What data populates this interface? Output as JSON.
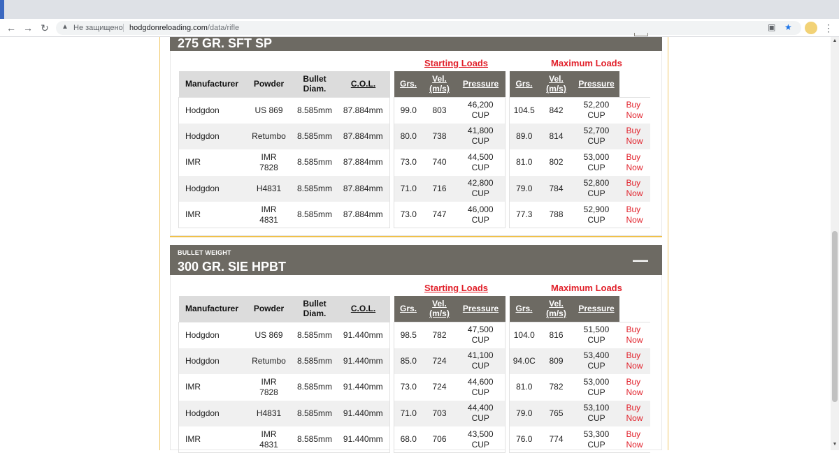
{
  "browser": {
    "security_label": "Не защищено",
    "url_host": "hodgdonreloading.com",
    "url_path": "/data/rifle"
  },
  "headers": {
    "starting": "Starting Loads",
    "maximum": "Maximum Loads",
    "manufacturer": "Manufacturer",
    "powder": "Powder",
    "bullet_diam_1": "Bullet",
    "bullet_diam_2": "Diam.",
    "col": "C.O.L.",
    "grs": "Grs.",
    "vel_1": "Vel.",
    "vel_2": "(m/s)",
    "pressure": "Pressure"
  },
  "sections": [
    {
      "label": "",
      "title": "275 GR. SFT SP",
      "toggle": "",
      "rows": [
        {
          "manufacturer": "Hodgdon",
          "powder1": "US 869",
          "powder2": "",
          "diam": "8.585mm",
          "col": "87.884mm",
          "s_grs": "99.0",
          "s_vel": "803",
          "s_p1": "46,200",
          "s_p2": "CUP",
          "m_grs": "104.5",
          "m_vel": "842",
          "m_p1": "52,200",
          "m_p2": "CUP",
          "buy1": "Buy",
          "buy2": "Now"
        },
        {
          "manufacturer": "Hodgdon",
          "powder1": "Retumbo",
          "powder2": "",
          "diam": "8.585mm",
          "col": "87.884mm",
          "s_grs": "80.0",
          "s_vel": "738",
          "s_p1": "41,800",
          "s_p2": "CUP",
          "m_grs": "89.0",
          "m_vel": "814",
          "m_p1": "52,700",
          "m_p2": "CUP",
          "buy1": "Buy",
          "buy2": "Now"
        },
        {
          "manufacturer": "IMR",
          "powder1": "IMR",
          "powder2": "7828",
          "diam": "8.585mm",
          "col": "87.884mm",
          "s_grs": "73.0",
          "s_vel": "740",
          "s_p1": "44,500",
          "s_p2": "CUP",
          "m_grs": "81.0",
          "m_vel": "802",
          "m_p1": "53,000",
          "m_p2": "CUP",
          "buy1": "Buy",
          "buy2": "Now"
        },
        {
          "manufacturer": "Hodgdon",
          "powder1": "H4831",
          "powder2": "",
          "diam": "8.585mm",
          "col": "87.884mm",
          "s_grs": "71.0",
          "s_vel": "716",
          "s_p1": "42,800",
          "s_p2": "CUP",
          "m_grs": "79.0",
          "m_vel": "784",
          "m_p1": "52,800",
          "m_p2": "CUP",
          "buy1": "Buy",
          "buy2": "Now"
        },
        {
          "manufacturer": "IMR",
          "powder1": "IMR",
          "powder2": "4831",
          "diam": "8.585mm",
          "col": "87.884mm",
          "s_grs": "73.0",
          "s_vel": "747",
          "s_p1": "46,000",
          "s_p2": "CUP",
          "m_grs": "77.3",
          "m_vel": "788",
          "m_p1": "52,900",
          "m_p2": "CUP",
          "buy1": "Buy",
          "buy2": "Now"
        }
      ]
    },
    {
      "label": "BULLET WEIGHT",
      "title": "300 GR. SIE HPBT",
      "toggle": "—",
      "rows": [
        {
          "manufacturer": "Hodgdon",
          "powder1": "US 869",
          "powder2": "",
          "diam": "8.585mm",
          "col": "91.440mm",
          "s_grs": "98.5",
          "s_vel": "782",
          "s_p1": "47,500",
          "s_p2": "CUP",
          "m_grs": "104.0",
          "m_vel": "816",
          "m_p1": "51,500",
          "m_p2": "CUP",
          "buy1": "Buy",
          "buy2": "Now"
        },
        {
          "manufacturer": "Hodgdon",
          "powder1": "Retumbo",
          "powder2": "",
          "diam": "8.585mm",
          "col": "91.440mm",
          "s_grs": "85.0",
          "s_vel": "724",
          "s_p1": "41,100",
          "s_p2": "CUP",
          "m_grs": "94.0C",
          "m_vel": "809",
          "m_p1": "53,400",
          "m_p2": "CUP",
          "buy1": "Buy",
          "buy2": "Now"
        },
        {
          "manufacturer": "IMR",
          "powder1": "IMR",
          "powder2": "7828",
          "diam": "8.585mm",
          "col": "91.440mm",
          "s_grs": "73.0",
          "s_vel": "724",
          "s_p1": "44,600",
          "s_p2": "CUP",
          "m_grs": "81.0",
          "m_vel": "782",
          "m_p1": "53,000",
          "m_p2": "CUP",
          "buy1": "Buy",
          "buy2": "Now"
        },
        {
          "manufacturer": "Hodgdon",
          "powder1": "H4831",
          "powder2": "",
          "diam": "8.585mm",
          "col": "91.440mm",
          "s_grs": "71.0",
          "s_vel": "703",
          "s_p1": "44,400",
          "s_p2": "CUP",
          "m_grs": "79.0",
          "m_vel": "765",
          "m_p1": "53,100",
          "m_p2": "CUP",
          "buy1": "Buy",
          "buy2": "Now"
        },
        {
          "manufacturer": "IMR",
          "powder1": "IMR",
          "powder2": "4831",
          "diam": "8.585mm",
          "col": "91.440mm",
          "s_grs": "68.0",
          "s_vel": "706",
          "s_p1": "43,500",
          "s_p2": "CUP",
          "m_grs": "76.0",
          "m_vel": "774",
          "m_p1": "53,300",
          "m_p2": "CUP",
          "buy1": "Buy",
          "buy2": "Now"
        }
      ]
    }
  ]
}
